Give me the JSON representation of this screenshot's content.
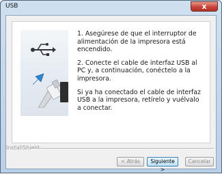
{
  "window": {
    "title": "USB",
    "close_label": "x"
  },
  "content": {
    "paragraphs": [
      "1. Asegúrese de que el interruptor de alimentación de la impresora está encendido.",
      "2. Conecte el cable de interfaz USB al PC y, a continuación, conéctelo a la impresora.",
      "Si ya ha conectado el cable de interfaz USB a la impresora, retírelo y vuélvalo a conectar."
    ]
  },
  "footer": {
    "brand": "InstallShield",
    "back_label": "< Atrás",
    "next_label": "Siguiente >",
    "cancel_label": "Cancelar"
  },
  "colors": {
    "accent": "#2f86cf",
    "close": "#c8443a"
  }
}
